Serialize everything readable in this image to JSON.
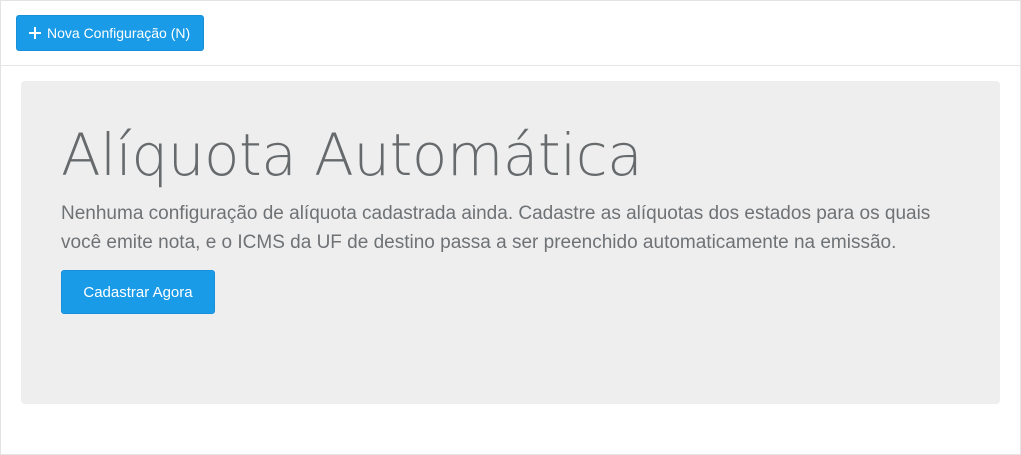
{
  "toolbar": {
    "new_config_label": "Nova Configuração (N)",
    "new_config_icon": "plus-icon"
  },
  "empty_state": {
    "title": "Alíquota Automática",
    "description": "Nenhuma configuração de alíquota cadastrada ainda. Cadastre as alíquotas dos estados para os quais você emite nota, e o ICMS da UF de destino passa a ser preenchido automaticamente na emissão.",
    "cta_label": "Cadastrar Agora"
  },
  "colors": {
    "primary": "#1a9be8",
    "panel_bg": "#eeeeee",
    "text": "#6f7275"
  }
}
